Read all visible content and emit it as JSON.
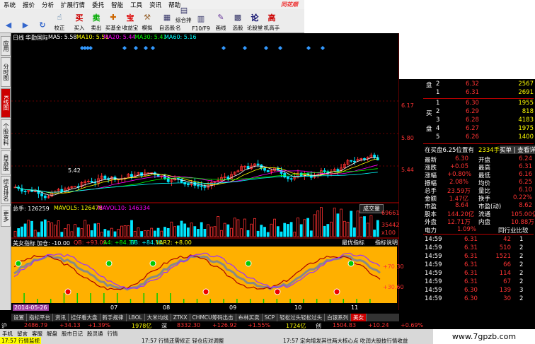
{
  "menu": [
    "系统",
    "报价",
    "分析",
    "扩展行情",
    "委托",
    "智能",
    "工具",
    "资讯",
    "帮助"
  ],
  "logo": "同花顺",
  "toolbar": [
    {
      "icon": "◀",
      "label": "",
      "name": "back"
    },
    {
      "icon": "▶",
      "label": "",
      "name": "forward"
    },
    {
      "icon": "↻",
      "label": "",
      "name": "refresh"
    },
    {
      "icon": "☝",
      "label": "校正",
      "name": "correct"
    },
    {
      "icon": "买",
      "label": "买入",
      "name": "buy"
    },
    {
      "icon": "卖",
      "label": "卖出",
      "name": "sell"
    },
    {
      "icon": "✚",
      "label": "买基金",
      "name": "fund"
    },
    {
      "icon": "宝",
      "label": "收益宝",
      "name": "earn"
    },
    {
      "icon": "⚒",
      "label": "模拟",
      "name": "simulate"
    },
    {
      "icon": "▦",
      "label": "自选股",
      "name": "watchlist"
    },
    {
      "icon": "▤",
      "label": "综合排名",
      "name": "ranking"
    },
    {
      "icon": "▥",
      "label": "F10/F9",
      "name": "f10"
    },
    {
      "icon": "✎",
      "label": "画线",
      "name": "draw"
    },
    {
      "icon": "▩",
      "label": "选股",
      "name": "select"
    },
    {
      "icon": "论",
      "label": "论股堂",
      "name": "forum"
    },
    {
      "icon": "高",
      "label": "机高手",
      "name": "expert"
    }
  ],
  "sidetabs": [
    "应用",
    "分时图",
    "K线图",
    "个股资料",
    "自选股",
    "综合排名",
    "更多"
  ],
  "header": {
    "period": "日线",
    "stock": "华勤国际",
    "ma5": "MA5: 5.58",
    "ma10": "MA10: 5.51",
    "ma20": "MA20: 5.44",
    "ma30": "MA30: 5.41",
    "ma60": "MA60: 5.16"
  },
  "price_axis": [
    "6.17",
    "5.80",
    "5.44"
  ],
  "low_label": "5.42",
  "volume": {
    "label": "总手: 126259",
    "mavol5": "MAVOL5: 126478",
    "mavol10": "MAVOL10: 146334",
    "button": "成交量",
    "axis_top": "69661",
    "axis_mid": "35442",
    "axis_low": "x100"
  },
  "indicator": {
    "label": "美女指标",
    "add": "加仓: -10.00",
    "qb": "QB: +93.09",
    "a": "A4: +84.37",
    "bb": "BB: +84.10",
    "var2": "VAR2: +8.00",
    "btn1": "最优指标",
    "btn2": "指标说明",
    "axis": [
      "+70.30",
      "+30.60"
    ]
  },
  "date_axis": {
    "cursor": "2014-05-26",
    "ticks": [
      "07",
      "08",
      "09",
      "10",
      "11"
    ]
  },
  "order_book": {
    "sell": [
      {
        "n": "2",
        "p": "6.32",
        "v": "2567"
      },
      {
        "n": "1",
        "p": "6.31",
        "v": "2691"
      }
    ],
    "buy": [
      {
        "n": "1",
        "p": "6.30",
        "v": "1955"
      },
      {
        "n": "2",
        "p": "6.29",
        "v": "818"
      },
      {
        "n": "3",
        "p": "6.28",
        "v": "4183"
      },
      {
        "n": "4",
        "p": "6.27",
        "v": "1975"
      },
      {
        "n": "5",
        "p": "6.26",
        "v": "1400"
      }
    ],
    "sell_label": "盘",
    "buy_label1": "买",
    "buy_label2": "盘"
  },
  "ticker_line": {
    "left": "在买盘6.25位置有",
    "mid": "2334手",
    "right": "买单 | 查看详细"
  },
  "stats": [
    [
      "最新",
      "6.30",
      "开盘",
      "6.24"
    ],
    [
      "涨跌",
      "+0.05",
      "最高",
      "6.31"
    ],
    [
      "涨幅",
      "+0.80%",
      "最低",
      "6.16"
    ],
    [
      "振幅",
      "2.08%",
      "均价",
      "6.25"
    ],
    [
      "总手",
      "23.59万",
      "量比",
      "6.10"
    ],
    [
      "金额",
      "1.47亿",
      "换手",
      "0.22%"
    ],
    [
      "市盈",
      "8.64",
      "市盈(动)",
      "8.62"
    ],
    [
      "股本",
      "144.20亿",
      "流通",
      "105.00亿"
    ],
    [
      "外盘",
      "12.71万",
      "内盘",
      "10.88万"
    ]
  ],
  "power": {
    "label": "电力",
    "value": "1.09%",
    "right": "同行业比较"
  },
  "ticks": [
    [
      "14:59",
      "6.31",
      "42",
      "1"
    ],
    [
      "14:59",
      "6.31",
      "510",
      "2"
    ],
    [
      "14:59",
      "6.31",
      "1521",
      "2"
    ],
    [
      "14:59",
      "6.31",
      "66",
      "2"
    ],
    [
      "14:59",
      "6.31",
      "114",
      "2"
    ],
    [
      "14:59",
      "6.31",
      "67",
      "2"
    ],
    [
      "14:59",
      "6.30",
      "139",
      "3"
    ],
    [
      "14:59",
      "6.30",
      "30",
      "2"
    ]
  ],
  "bottom_tabs": [
    "设置",
    "指标平台",
    "资讯",
    "挂仔看大盘",
    "新手规律",
    "LBOL",
    "大米均线",
    "ZTKX",
    "CHMCU筹码出击",
    "布林买卖",
    "SCP",
    "轻松过头轻松过头",
    "白银系列",
    "美女"
  ],
  "index_bar": {
    "sh": "沪",
    "sh_val": "2486.79",
    "sh_chg": "+34.13",
    "sh_pct": "+1.39%",
    "sh_amt": "1978亿",
    "sz": "深",
    "sz_val": "8332.30",
    "sz_chg": "+126.92",
    "sz_pct": "+1.55%",
    "sz_amt": "1724亿",
    "cy": "创",
    "cy_val": "1504.83",
    "cy_chg": "+10.24",
    "cy_pct": "+0.69%"
  },
  "news": {
    "n1": "17:57 行情监视",
    "n2": "17:57 行情还需修正 轻仓应对调整",
    "n3": "17:57 定向增发其往两大核心点 吃润大股技行情收益"
  },
  "footer": [
    "手机",
    "留言",
    "客服",
    "解盘",
    "股市日记",
    "股灵通",
    "行情"
  ],
  "watermark": "www.7gpzb.com",
  "colors": {
    "up": "#ff3030",
    "down": "#00e5ff",
    "yellow": "#ffff00",
    "orange": "#ffb000",
    "purple": "#9b30ff"
  }
}
